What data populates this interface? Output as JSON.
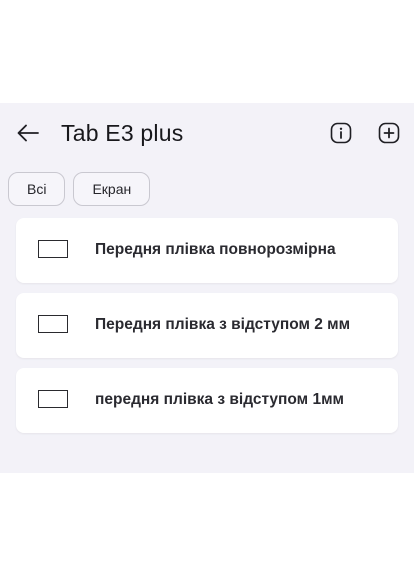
{
  "header": {
    "title": "Tab E3 plus",
    "back_icon": "arrow-left-icon",
    "info_icon": "info-icon",
    "add_icon": "add-icon"
  },
  "filters": [
    {
      "label": "Всі"
    },
    {
      "label": "Екран"
    }
  ],
  "items": [
    {
      "label": "Передня плівка повнорозмірна",
      "icon": "rectangle-outline-icon"
    },
    {
      "label": "Передня плівка з відступом 2 мм",
      "icon": "rectangle-outline-icon"
    },
    {
      "label": "передня плівка з відступом 1мм",
      "icon": "rectangle-outline-icon"
    }
  ],
  "colors": {
    "panel_background": "#f3f2f8",
    "card_background": "#ffffff",
    "text": "#2a2a30"
  }
}
